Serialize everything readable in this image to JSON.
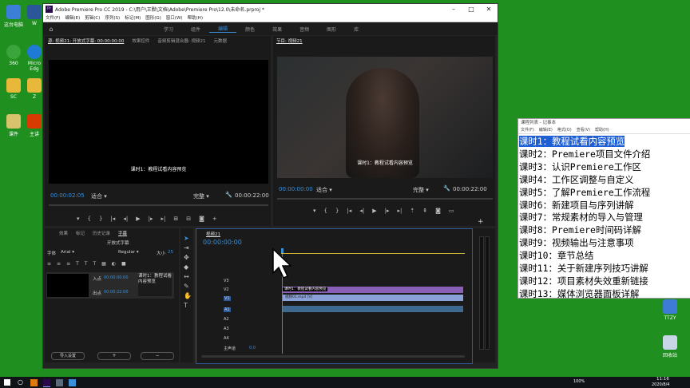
{
  "desktop_icons": [
    {
      "label": "这台电脑",
      "color": "#3b7fd6"
    },
    {
      "label": "W",
      "color": "#2b579a"
    },
    {
      "label": "360",
      "color": "#3aa53a"
    },
    {
      "label": "Micro Edg",
      "color": "#1f7ad6"
    },
    {
      "label": "SC",
      "color": "#e8b83a"
    },
    {
      "label": "Z",
      "color": "#e8b83a"
    },
    {
      "label": "课件",
      "color": "#d7c36b"
    },
    {
      "label": "主讲",
      "color": "#d83b01"
    },
    {
      "label": "TTZY",
      "color": "#3e7bd6"
    },
    {
      "label": "回收站",
      "color": "#c9d6e8"
    }
  ],
  "premiere": {
    "title": "Adobe Premiere Pro CC 2019 - C:\\用户\\王默\\文档\\Adobe\\Premiere Pro\\12.0\\未命名.prproj *",
    "menu": [
      "文件(F)",
      "编辑(E)",
      "剪辑(C)",
      "序列(S)",
      "标记(M)",
      "图形(G)",
      "窗口(W)",
      "帮助(H)"
    ],
    "workspaces": [
      "学习",
      "组件",
      "编辑",
      "颜色",
      "效果",
      "音频",
      "图形",
      "库"
    ],
    "active_workspace": "编辑",
    "source": {
      "tabs": [
        "源: 视频21: 开放式字幕: 00:00:00:00",
        "效果控件",
        "音频剪辑混合器: 视频21",
        "元数据"
      ],
      "caption": "课时1：教程试看内容预览",
      "timecode": "00:00:02:05",
      "fit": "适合",
      "quality": "完整",
      "duration": "00:00:22:00"
    },
    "program": {
      "tab": "节目: 视频21",
      "caption": "课时1：教程试看内容预览",
      "timecode": "00:00:00:00",
      "fit": "适合",
      "quality": "完整",
      "duration": "00:00:22:00"
    },
    "project": {
      "tabs": [
        "效果",
        "标记",
        "历史记录",
        "字幕"
      ],
      "active_tab": "字幕",
      "sub_label": "开放式字幕",
      "font_label": "字体",
      "font": "Arial",
      "style": "Regular",
      "size_label": "大小",
      "size": "25",
      "in_label": "入点",
      "in_tc": "00:00:00:00",
      "out_label": "出点",
      "out_tc": "00:00:22:00",
      "clip_text": "课时1：教程试看内容预览",
      "import_btn": "导入设置",
      "add_btn": "+",
      "remove_btn": "−"
    },
    "timeline": {
      "tab": "视频21",
      "timecode": "00:00:00:00",
      "tracks": [
        "V3",
        "V2",
        "V1",
        "A1",
        "A2",
        "A3",
        "A4"
      ],
      "master": "主声道",
      "master_val": "0.0",
      "caption_clip": "课时1：教程试看内容预览",
      "video_clip": "视频01.mp4 [V]"
    }
  },
  "notepad": {
    "title": "课程列表 - 记事本",
    "menu": [
      "文件(F)",
      "编辑(E)",
      "格式(O)",
      "查看(V)",
      "帮助(H)"
    ],
    "lines": [
      "课时1：教程试看内容预览",
      "课时2：Premiere项目文件介绍",
      "课时3：认识Premiere工作区",
      "课时4：工作区调整与自定义",
      "课时5：了解Premiere工作流程",
      "课时6：新建项目与序列讲解",
      "课时7：常规素材的导入与管理",
      "课时8：Premiere时间码详解",
      "课时9：视频输出与注意事项",
      "课时10：章节总结",
      "课时11：关于新建序列技巧讲解",
      "课时12：项目素材失效重新链接",
      "课时13：媒体浏览器面板详解"
    ],
    "selected_line": 0
  },
  "taskbar": {
    "time": "11:16",
    "date": "2020/8/4",
    "battery": "100%"
  }
}
